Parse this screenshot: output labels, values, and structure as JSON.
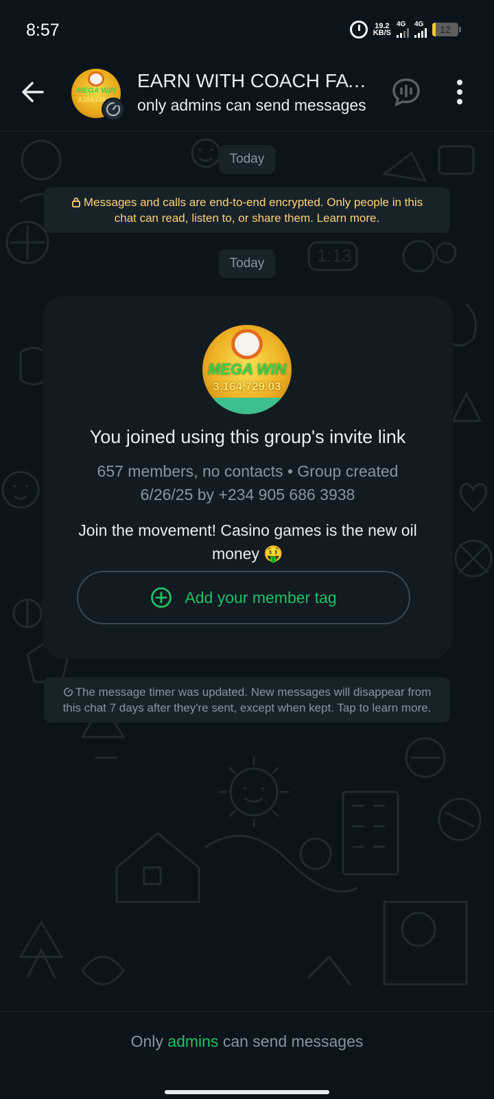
{
  "status_bar": {
    "time": "8:57",
    "net_speed_value": "19.2",
    "net_speed_unit": "KB/S",
    "signal1_label": "4G",
    "signal2_label": "4G",
    "battery": "12",
    "battery_level": 0.12
  },
  "header": {
    "title": "EARN WITH COACH FAVOUR",
    "subtitle": "only admins can send messages",
    "avatar_text": "MEGA WIN",
    "avatar_number": "3,164,729.03"
  },
  "chat": {
    "date_chip_1": "Today",
    "encryption_notice": "Messages and calls are end-to-end encrypted. Only people in this chat can read, listen to, or share them. Learn more.",
    "date_chip_2": "Today",
    "info_card": {
      "avatar_text": "MEGA WIN",
      "avatar_number": "3,164,729.03",
      "title": "You joined using this group's invite link",
      "meta": "657 members, no contacts • Group created 6/26/25 by +234 905 686 3938",
      "description": "Join the movement! Casino games is the new oil money 🤑",
      "member_tag_label": "Add your member tag"
    },
    "timer_notice": "The message timer was updated. New messages will disappear from this chat 7 days after they're sent, except when kept. Tap to learn more."
  },
  "footer": {
    "prefix": "Only ",
    "accent_word": "admins",
    "suffix": " can send messages"
  },
  "colors": {
    "background": "#0b141a",
    "accent_green": "#21c063",
    "encryption_yellow": "#ffd279",
    "muted_text": "#8696a0"
  }
}
